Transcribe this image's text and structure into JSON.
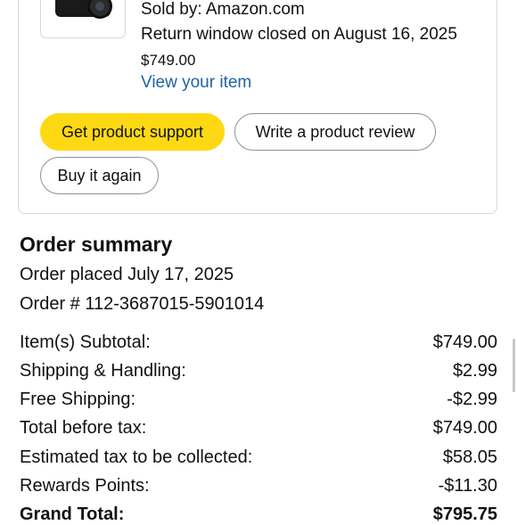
{
  "item": {
    "sold_by": "Sold by: Amazon.com",
    "return_window": "Return window closed on August 16, 2025",
    "price": "$749.00",
    "view_item_link": "View your item"
  },
  "buttons": {
    "product_support": "Get product support",
    "write_review": "Write a product review",
    "buy_again": "Buy it again"
  },
  "summary": {
    "title": "Order summary",
    "order_placed": "Order placed July 17, 2025",
    "order_number": "Order # 112-3687015-5901014",
    "rows": [
      {
        "label": "Item(s) Subtotal:",
        "value": "$749.00"
      },
      {
        "label": "Shipping & Handling:",
        "value": "$2.99"
      },
      {
        "label": "Free Shipping:",
        "value": "-$2.99"
      },
      {
        "label": "Total before tax:",
        "value": "$749.00"
      },
      {
        "label": "Estimated tax to be collected:",
        "value": "$58.05"
      },
      {
        "label": "Rewards Points:",
        "value": "-$11.30"
      },
      {
        "label": "Grand Total:",
        "value": "$795.75"
      }
    ]
  },
  "colors": {
    "primary_button": "#ffd814",
    "link": "#2162a1",
    "border": "#d5d9d9"
  }
}
